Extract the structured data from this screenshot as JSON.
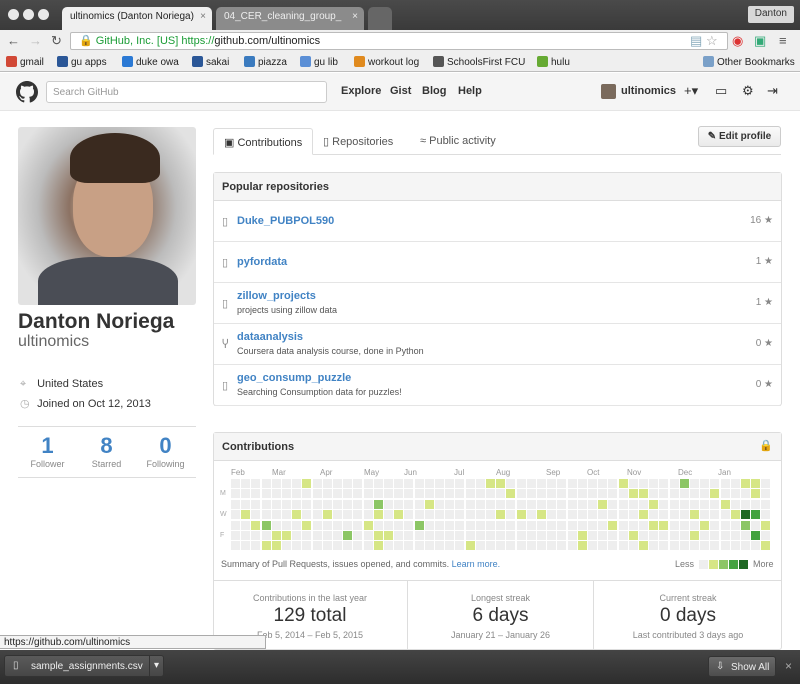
{
  "browser": {
    "tabs": [
      {
        "title": "ultinomics (Danton Noriega)",
        "close": "×"
      },
      {
        "title": "04_CER_cleaning_group_",
        "close": "×"
      }
    ],
    "profile_name": "Danton",
    "ev_label": "GitHub, Inc. [US]",
    "url_scheme": "https://",
    "url_host": "github.com/ultinomics",
    "bookmarks": [
      {
        "label": "gmail",
        "color": "#d14836"
      },
      {
        "label": "gu apps",
        "color": "#2b5797"
      },
      {
        "label": "duke owa",
        "color": "#2b79d4"
      },
      {
        "label": "sakai",
        "color": "#2b5797"
      },
      {
        "label": "piazza",
        "color": "#3b7bbf"
      },
      {
        "label": "gu lib",
        "color": "#5b8fd6"
      },
      {
        "label": "workout log",
        "color": "#e08a1e"
      },
      {
        "label": "SchoolsFirst FCU",
        "color": "#555555"
      },
      {
        "label": "hulu",
        "color": "#66aa33"
      }
    ],
    "other_bookmarks": "Other Bookmarks",
    "status_url": "https://github.com/ultinomics"
  },
  "gh_header": {
    "search_placeholder": "Search GitHub",
    "nav": [
      "Explore",
      "Gist",
      "Blog",
      "Help"
    ],
    "username": "ultinomics",
    "plus": "+▾"
  },
  "profile": {
    "name": "Danton Noriega",
    "login": "ultinomics",
    "location": "United States",
    "joined": "Joined on Oct 12, 2013",
    "stats": [
      {
        "num": "1",
        "label": "Follower"
      },
      {
        "num": "8",
        "label": "Starred"
      },
      {
        "num": "0",
        "label": "Following"
      }
    ]
  },
  "tabs": {
    "contributions": "Contributions",
    "repositories": "Repositories",
    "public_activity": "Public activity",
    "edit_profile": "Edit profile"
  },
  "popular": {
    "heading": "Popular repositories",
    "repos": [
      {
        "name": "Duke_PUBPOL590",
        "desc": "",
        "stars": "16",
        "icon": "repo-icon"
      },
      {
        "name": "pyfordata",
        "desc": "",
        "stars": "1",
        "icon": "repo-icon"
      },
      {
        "name": "zillow_projects",
        "desc": "projects using zillow data",
        "stars": "1",
        "icon": "repo-icon"
      },
      {
        "name": "dataanalysis",
        "desc": "Coursera data analysis course, done in Python",
        "stars": "0",
        "icon": "fork-icon"
      },
      {
        "name": "geo_consump_puzzle",
        "desc": "Searching Consumption data for puzzles!",
        "stars": "0",
        "icon": "repo-icon"
      }
    ]
  },
  "contrib": {
    "heading": "Contributions",
    "months": [
      "Feb",
      "Mar",
      "Apr",
      "May",
      "Jun",
      "Jul",
      "Aug",
      "Sep",
      "Oct",
      "Nov",
      "Dec",
      "Jan"
    ],
    "day_labels": [
      "M",
      "W",
      "F"
    ],
    "summary": "Summary of Pull Requests, issues opened, and commits.",
    "learn_more": "Learn more.",
    "legend_less": "Less",
    "legend_more": "More",
    "colors": [
      "#eeeeee",
      "#d6e685",
      "#8cc665",
      "#44a340",
      "#1e6823"
    ],
    "stats": [
      {
        "title": "Contributions in the last year",
        "value": "129 total",
        "sub": "Feb 5, 2014 – Feb 5, 2015"
      },
      {
        "title": "Longest streak",
        "value": "6 days",
        "sub": "January 21 – January 26"
      },
      {
        "title": "Current streak",
        "value": "0 days",
        "sub": "Last contributed 3 days ago"
      }
    ]
  },
  "downloads": {
    "file": "sample_assignments.csv",
    "show_all": "Show All"
  }
}
